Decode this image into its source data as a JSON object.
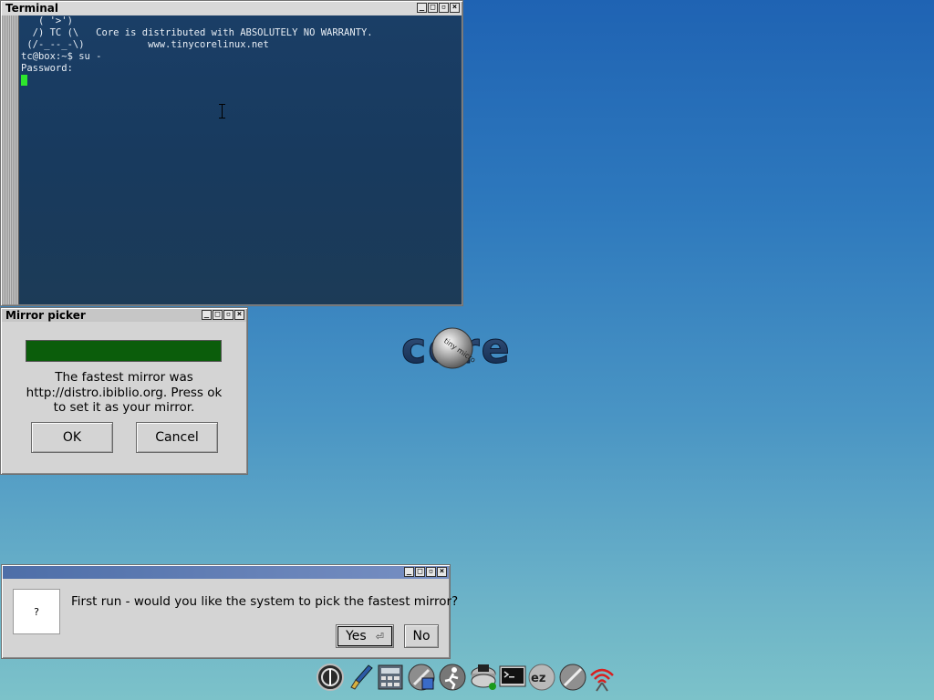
{
  "terminal": {
    "title": "Terminal",
    "lines": [
      "   ( '>')",
      "  /) TC (\\   Core is distributed with ABSOLUTELY NO WARRANTY.",
      " (/-_--_-\\)           www.tinycorelinux.net",
      "",
      "tc@box:~$ su -",
      "Password:"
    ]
  },
  "mirror_picker": {
    "title": "Mirror picker",
    "progress": 1.0,
    "message": "The fastest mirror was http://distro.ibiblio.org. Press ok to set it as your mirror.",
    "ok_label": "OK",
    "cancel_label": "Cancel"
  },
  "first_run": {
    "title": "",
    "icon_text": "?",
    "question": "First run - would you like the system to pick the fastest mirror?",
    "yes_label": "Yes",
    "no_label": "No"
  },
  "desktop": {
    "logo_text": "core",
    "logo_badge": "tiny micro"
  },
  "dock": {
    "items": [
      "power-icon",
      "paint-brush-icon",
      "calculator-icon",
      "install-icon",
      "run-icon",
      "drive-icon",
      "terminal-icon",
      "ez-icon",
      "apps-icon",
      "wifi-icon"
    ]
  },
  "colors": {
    "progress_fill": "#0b5d0b",
    "terminal_cursor": "#2ee62e"
  }
}
